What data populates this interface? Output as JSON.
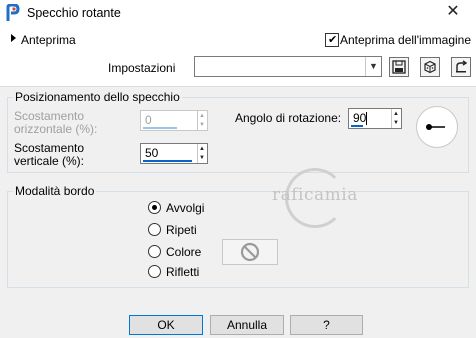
{
  "window": {
    "title": "Specchio rotante",
    "close_glyph": "✕"
  },
  "header": {
    "preview_label": "Anteprima",
    "image_preview_label": "Anteprima dell'immagine",
    "image_preview_checked": true,
    "settings_label": "Impostazioni",
    "settings_value": ""
  },
  "mirror_group": {
    "title": "Posizionamento dello specchio",
    "horizontal_offset": {
      "label_line1": "Scostamento",
      "label_line2": "orizzontale (%):",
      "value": "0",
      "enabled": false
    },
    "vertical_offset": {
      "label_line1": "Scostamento",
      "label_line2": "verticale (%):",
      "value": "50",
      "enabled": true
    },
    "rotation_angle": {
      "label": "Angolo di rotazione:",
      "value": "90"
    }
  },
  "edge_group": {
    "title": "Modalità bordo",
    "options": [
      "Avvolgi",
      "Ripeti",
      "Colore",
      "Rifletti"
    ],
    "selected": "Avvolgi"
  },
  "buttons": {
    "ok": "OK",
    "cancel": "Annulla",
    "help": "?"
  },
  "watermark": {
    "text": "raficamia"
  },
  "colors": {
    "accent": "#0a64c8",
    "focus_border": "#0078d7"
  }
}
